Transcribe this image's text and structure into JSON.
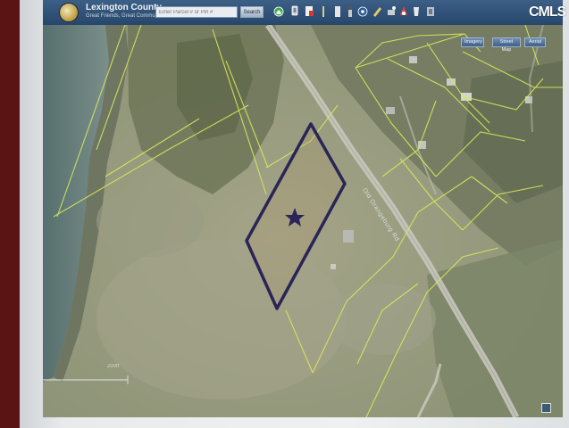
{
  "header": {
    "title": "Lexington County",
    "tagline": "Great Friends, Great Communities"
  },
  "search": {
    "placeholder": "Enter Parcel # or Pin #",
    "button_label": "Search"
  },
  "toolbar": {
    "tools": [
      "home-icon",
      "pin-icon",
      "measure-icon",
      "ruler-icon",
      "info-icon",
      "identify-icon",
      "select-icon",
      "draw-icon",
      "print-icon",
      "export-icon",
      "layers-icon",
      "help-icon"
    ]
  },
  "map_controls": {
    "imagery_label": "Imagery",
    "street_map_label": "Street Map",
    "aerial_label": "Aerial"
  },
  "map": {
    "road_label": "Old Orangeburg Rd",
    "scale_label": "200ft",
    "colors": {
      "parcel_lines": "#d8e85a",
      "selected_parcel": "#2a2556",
      "water": "#6f8884"
    }
  },
  "watermark": {
    "text": "CMLS"
  }
}
